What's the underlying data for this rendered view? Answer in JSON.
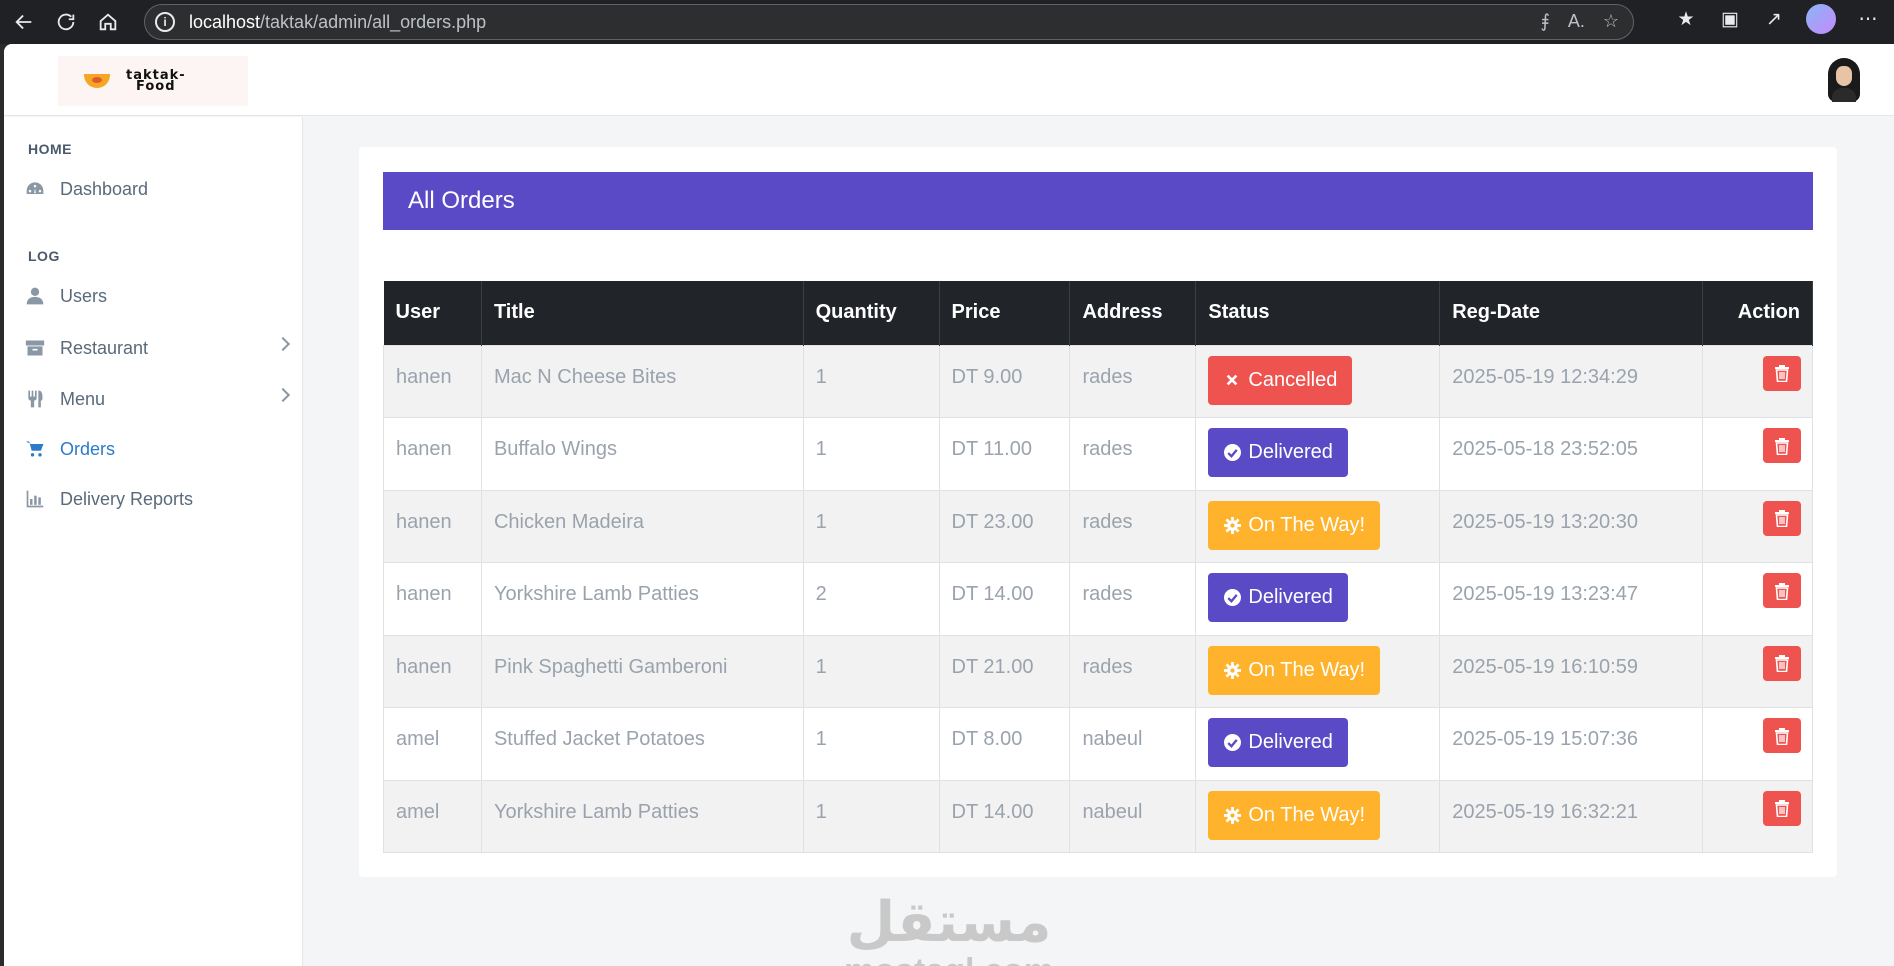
{
  "browser": {
    "url_host": "localhost",
    "url_path": "/taktak/admin/all_orders.php"
  },
  "logo": {
    "line1": "taktak-",
    "line2": "Food"
  },
  "sidebar": {
    "headings": [
      "HOME",
      "LOG"
    ],
    "items": [
      {
        "label": "Dashboard",
        "icon": "dashboard-icon"
      },
      {
        "label": "Users",
        "icon": "user-icon"
      },
      {
        "label": "Restaurant",
        "icon": "archive-icon"
      },
      {
        "label": "Menu",
        "icon": "cutlery-icon"
      },
      {
        "label": "Orders",
        "icon": "cart-icon"
      },
      {
        "label": "Delivery Reports",
        "icon": "bar-chart-icon"
      }
    ]
  },
  "main": {
    "title": "All Orders",
    "columns": [
      "User",
      "Title",
      "Quantity",
      "Price",
      "Address",
      "Status",
      "Reg-Date",
      "Action"
    ],
    "rows": [
      {
        "user": "hanen",
        "title": "Mac N Cheese Bites",
        "quantity": "1",
        "price": "DT 9.00",
        "address": "rades",
        "status": "Cancelled",
        "date": "2025-05-19 12:34:29"
      },
      {
        "user": "hanen",
        "title": "Buffalo Wings",
        "quantity": "1",
        "price": "DT 11.00",
        "address": "rades",
        "status": "Delivered",
        "date": "2025-05-18 23:52:05"
      },
      {
        "user": "hanen",
        "title": "Chicken Madeira",
        "quantity": "1",
        "price": "DT 23.00",
        "address": "rades",
        "status": "On The Way!",
        "date": "2025-05-19 13:20:30"
      },
      {
        "user": "hanen",
        "title": "Yorkshire Lamb Patties",
        "quantity": "2",
        "price": "DT 14.00",
        "address": "rades",
        "status": "Delivered",
        "date": "2025-05-19 13:23:47"
      },
      {
        "user": "hanen",
        "title": "Pink Spaghetti Gamberoni",
        "quantity": "1",
        "price": "DT 21.00",
        "address": "rades",
        "status": "On The Way!",
        "date": "2025-05-19 16:10:59"
      },
      {
        "user": "amel",
        "title": "Stuffed Jacket Potatoes",
        "quantity": "1",
        "price": "DT 8.00",
        "address": "nabeul",
        "status": "Delivered",
        "date": "2025-05-19 15:07:36"
      },
      {
        "user": "amel",
        "title": "Yorkshire Lamb Patties",
        "quantity": "1",
        "price": "DT 14.00",
        "address": "nabeul",
        "status": "On The Way!",
        "date": "2025-05-19 16:32:21"
      }
    ]
  },
  "watermark": {
    "arabic": "مستقل",
    "latin": "mostaql.com"
  },
  "colors": {
    "accent": "#5b4ac6",
    "cancelled": "#ef5350",
    "delivered": "#5b4ac6",
    "on_the_way": "#ffb22b",
    "table_header": "#212529",
    "sidebar_active": "#2b7bc9"
  }
}
